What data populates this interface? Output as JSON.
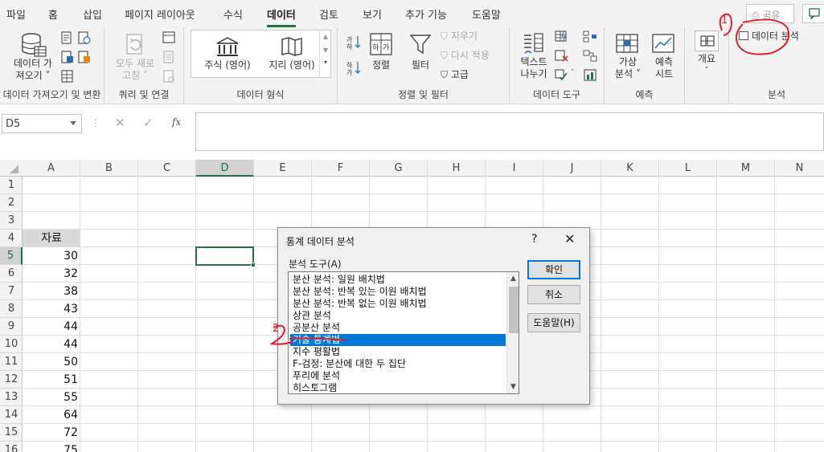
{
  "menu": {
    "tabs": [
      "파일",
      "홈",
      "삽입",
      "페이지 레이아웃",
      "수식",
      "데이터",
      "검토",
      "보기",
      "추가 기능",
      "도움말"
    ],
    "active": "데이터",
    "share_label": "공유"
  },
  "ribbon": {
    "groups": {
      "get_data": "데이터 가져오기 및 변환",
      "queries": "쿼리 및 연결",
      "data_types": "데이터 형식",
      "sort_filter": "정렬 및 필터",
      "data_tools": "데이터 도구",
      "forecast": "예측",
      "outline_blank": "",
      "analysis": "분석"
    },
    "get_data_line1": "데이터 가",
    "get_data_line2": "져오기 ˅",
    "refresh_line1": "모두 새로",
    "refresh_line2": "고침 ˅",
    "stocks": "주식 (영어)",
    "geography": "지리 (영어)",
    "sort": "정렬",
    "filter": "필터",
    "clear": "지우기",
    "reapply": "다시 적용",
    "advanced": "고급",
    "text_to_columns_line1": "텍스트",
    "text_to_columns_line2": "나누기",
    "whatif_line1": "가상",
    "whatif_line2": "분석 ˅",
    "forecast_line1": "예측",
    "forecast_line2": "시트",
    "outline": "개요",
    "data_analysis": "데이터 분석"
  },
  "formula_bar": {
    "name_box": "D5",
    "fx": "fx"
  },
  "grid": {
    "columns": [
      "A",
      "B",
      "C",
      "D",
      "E",
      "F",
      "G",
      "H",
      "I",
      "J",
      "K",
      "L",
      "M",
      "N"
    ],
    "selected_column": "D",
    "rows": [
      "1",
      "2",
      "3",
      "4",
      "5",
      "6",
      "7",
      "8",
      "9",
      "10",
      "11",
      "12",
      "13",
      "14",
      "15",
      "16"
    ],
    "selected_row": "5",
    "header_cell": "자료",
    "values": [
      "30",
      "32",
      "38",
      "43",
      "44",
      "44",
      "50",
      "51",
      "55",
      "64",
      "72",
      "75"
    ]
  },
  "dialog": {
    "title": "통계 데이터 분석",
    "help": "?",
    "close": "✕",
    "list_label": "분석 도구(A)",
    "tools": [
      "분산 분석: 일원 배치법",
      "분산 분석: 반복 있는 이원 배치법",
      "분산 분석: 반복 없는 이원 배치법",
      "상관 분석",
      "공분산 분석",
      "기술 통계법",
      "지수 평활법",
      "F-검정: 분산에 대한 두 집단",
      "푸리에 분석",
      "히스토그램"
    ],
    "selected_tool": "기술 통계법",
    "ok": "확인",
    "cancel": "취소",
    "help_button": "도움말(H)"
  },
  "annotations": {
    "mark1": "1",
    "mark2": "2",
    "color": "#e0202a"
  },
  "colors": {
    "accent": "#217346",
    "selection": "#0078d7"
  }
}
